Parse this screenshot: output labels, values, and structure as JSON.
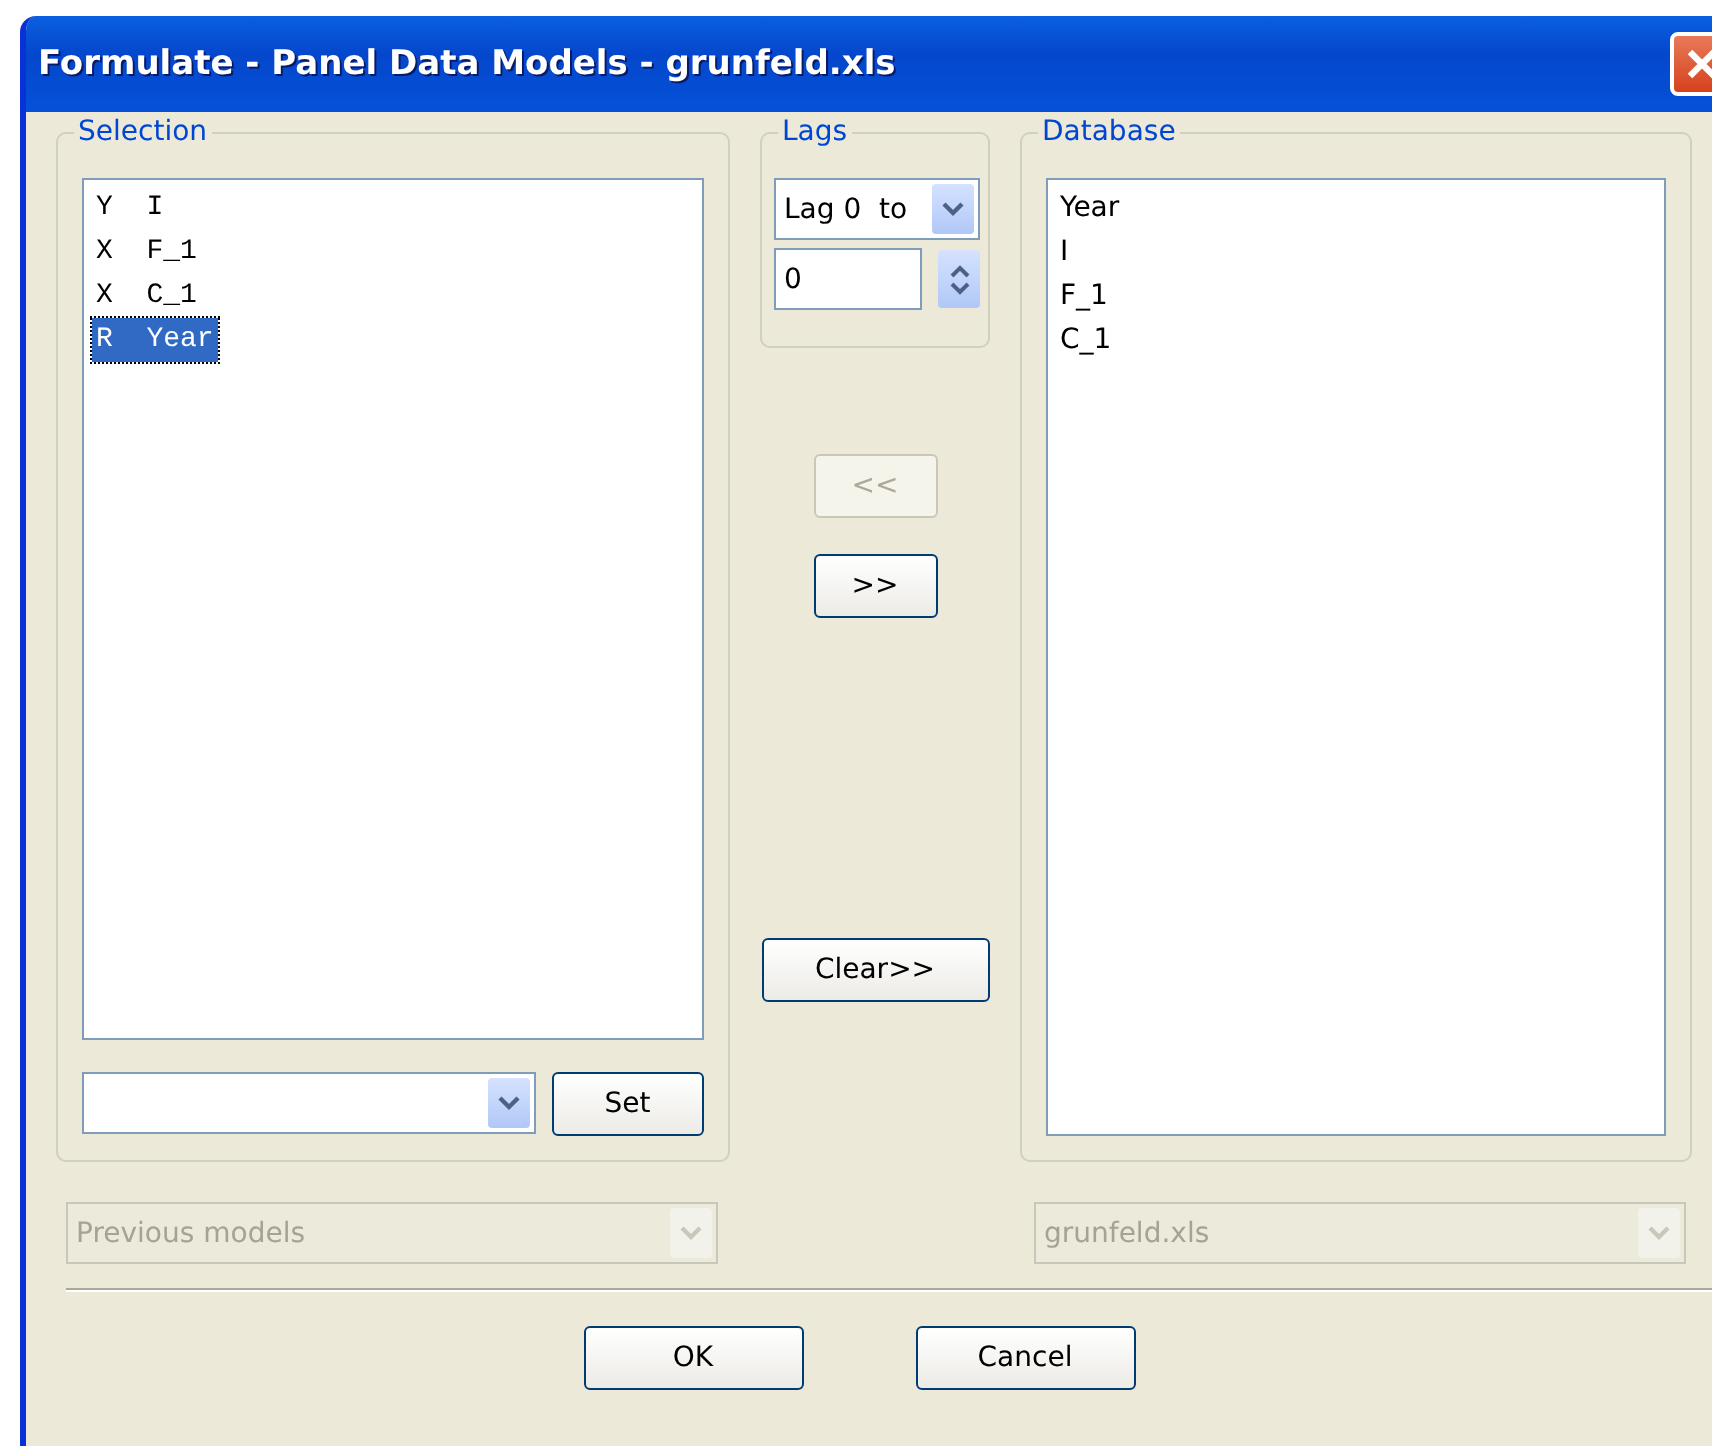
{
  "window": {
    "title": "Formulate - Panel Data Models - grunfeld.xls"
  },
  "selection": {
    "title": "Selection",
    "items": [
      {
        "text": "Y  I",
        "selected": false
      },
      {
        "text": "X  F_1",
        "selected": false
      },
      {
        "text": "X  C_1",
        "selected": false
      },
      {
        "text": "R  Year",
        "selected": true
      }
    ],
    "set_button": {
      "label": "Set"
    }
  },
  "lags": {
    "title": "Lags",
    "combo": "Lag 0  to",
    "spinner": "0"
  },
  "move_buttons": [
    {
      "label": "<<",
      "disabled": true
    },
    {
      "label": ">>",
      "disabled": false
    }
  ],
  "clear_button": {
    "label": "Clear>>",
    "disabled": false
  },
  "database": {
    "title": "Database",
    "items": [
      {
        "text": "Year",
        "selected": false
      },
      {
        "text": "I",
        "selected": false
      },
      {
        "text": "F_1",
        "selected": false
      },
      {
        "text": "C_1",
        "selected": false
      }
    ]
  },
  "previous_models": {
    "value": "Previous models",
    "disabled": true
  },
  "file_combo": {
    "value": "grunfeld.xls",
    "disabled": true
  },
  "buttons": [
    {
      "label": "OK"
    },
    {
      "label": "Cancel"
    }
  ]
}
